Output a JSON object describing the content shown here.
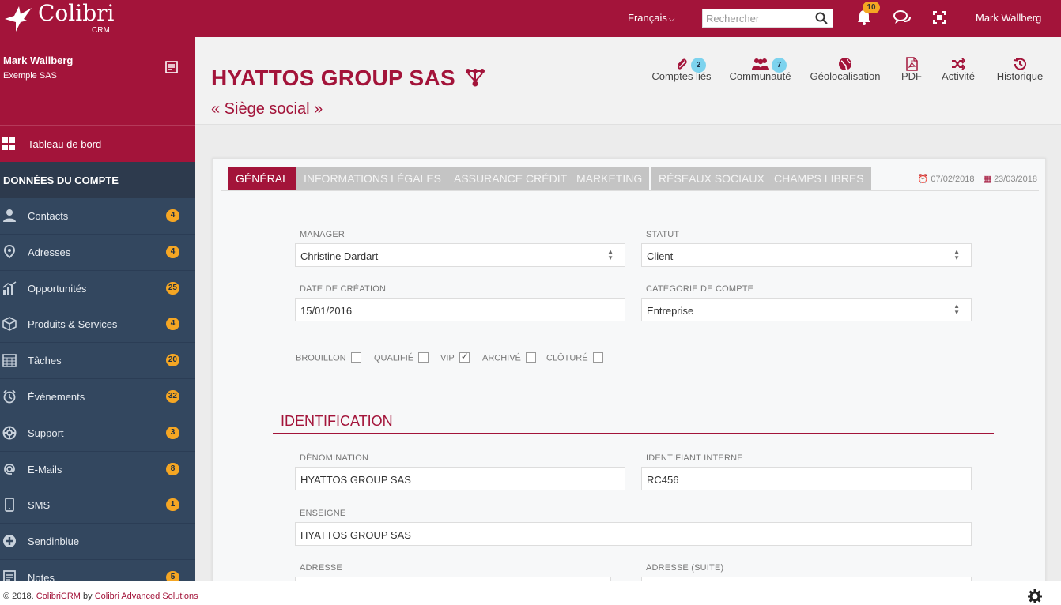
{
  "app": {
    "logo_text": "Colibri",
    "logo_sub": "CRM"
  },
  "topbar": {
    "language": "Français",
    "search_placeholder": "Rechercher",
    "notifications_count": "10",
    "user": "Mark Wallberg"
  },
  "sidebar": {
    "user_name": "Mark Wallberg",
    "company": "Exemple SAS",
    "dashboard": "Tableau de bord",
    "section": "DONNÉES DU COMPTE",
    "items": [
      {
        "label": "Contacts",
        "badge": "4",
        "icon": "contacts-icon"
      },
      {
        "label": "Adresses",
        "badge": "4",
        "icon": "location-icon"
      },
      {
        "label": "Opportunités",
        "badge": "25",
        "icon": "chart-icon"
      },
      {
        "label": "Produits & Services",
        "badge": "4",
        "icon": "cube-icon"
      },
      {
        "label": "Tâches",
        "badge": "20",
        "icon": "calendar-grid-icon"
      },
      {
        "label": "Événements",
        "badge": "32",
        "icon": "alarm-icon"
      },
      {
        "label": "Support",
        "badge": "3",
        "icon": "lifebuoy-icon"
      },
      {
        "label": "E-Mails",
        "badge": "8",
        "icon": "at-icon"
      },
      {
        "label": "SMS",
        "badge": "1",
        "icon": "mobile-icon"
      },
      {
        "label": "Sendinblue",
        "badge": "",
        "icon": "plus-circle-icon"
      },
      {
        "label": "Notes",
        "badge": "5",
        "icon": "note-icon"
      }
    ]
  },
  "header": {
    "title": "HYATTOS GROUP SAS",
    "subtitle": "« Siège social »",
    "actions": [
      {
        "label": "Comptes liés",
        "badge": "2",
        "icon": "paperclip-icon"
      },
      {
        "label": "Communauté",
        "badge": "7",
        "icon": "users-icon"
      },
      {
        "label": "Géolocalisation",
        "badge": "",
        "icon": "globe-icon"
      },
      {
        "label": "PDF",
        "badge": "",
        "icon": "pdf-icon"
      },
      {
        "label": "Activité",
        "badge": "",
        "icon": "shuffle-icon"
      },
      {
        "label": "Historique",
        "badge": "",
        "icon": "history-icon"
      }
    ]
  },
  "tabs": [
    {
      "label": "GÉNÉRAL",
      "active": true
    },
    {
      "label": "INFORMATIONS LÉGALES",
      "active": false
    },
    {
      "label": "ASSURANCE CRÉDIT",
      "active": false
    },
    {
      "label": "MARKETING",
      "active": false
    },
    {
      "label": "RÉSEAUX SOCIAUX",
      "active": false
    },
    {
      "label": "CHAMPS LIBRES",
      "active": false
    }
  ],
  "dates": {
    "created": "07/02/2018",
    "modified": "23/03/2018"
  },
  "form": {
    "manager": {
      "label": "MANAGER",
      "value": "Christine Dardart"
    },
    "statut": {
      "label": "STATUT",
      "value": "Client"
    },
    "date_creation": {
      "label": "DATE DE CRÉATION",
      "value": "15/01/2016"
    },
    "categorie": {
      "label": "CATÉGORIE DE COMPTE",
      "value": "Entreprise"
    },
    "checkboxes": [
      {
        "label": "BROUILLON",
        "checked": false
      },
      {
        "label": "QUALIFIÉ",
        "checked": false
      },
      {
        "label": "VIP",
        "checked": true
      },
      {
        "label": "ARCHIVÉ",
        "checked": false
      },
      {
        "label": "CLÔTURÉ",
        "checked": false
      }
    ],
    "identification": {
      "title": "IDENTIFICATION",
      "denomination": {
        "label": "DÉNOMINATION",
        "value": "HYATTOS GROUP SAS"
      },
      "identifiant": {
        "label": "IDENTIFIANT INTERNE",
        "value": "RC456"
      },
      "enseigne": {
        "label": "ENSEIGNE",
        "value": "HYATTOS GROUP SAS"
      },
      "adresse": {
        "label": "ADRESSE",
        "value": ""
      },
      "adresse_suite": {
        "label": "ADRESSE (SUITE)",
        "value": ""
      }
    }
  },
  "footer": {
    "prefix": "© 2018. ",
    "product": "ColibriCRM",
    "by": " by ",
    "company": "Colibri Advanced Solutions"
  },
  "colors": {
    "brand": "#a3143a",
    "sidebar": "#33475f",
    "badge": "#f5a623",
    "info_badge": "#7dd3ee"
  }
}
